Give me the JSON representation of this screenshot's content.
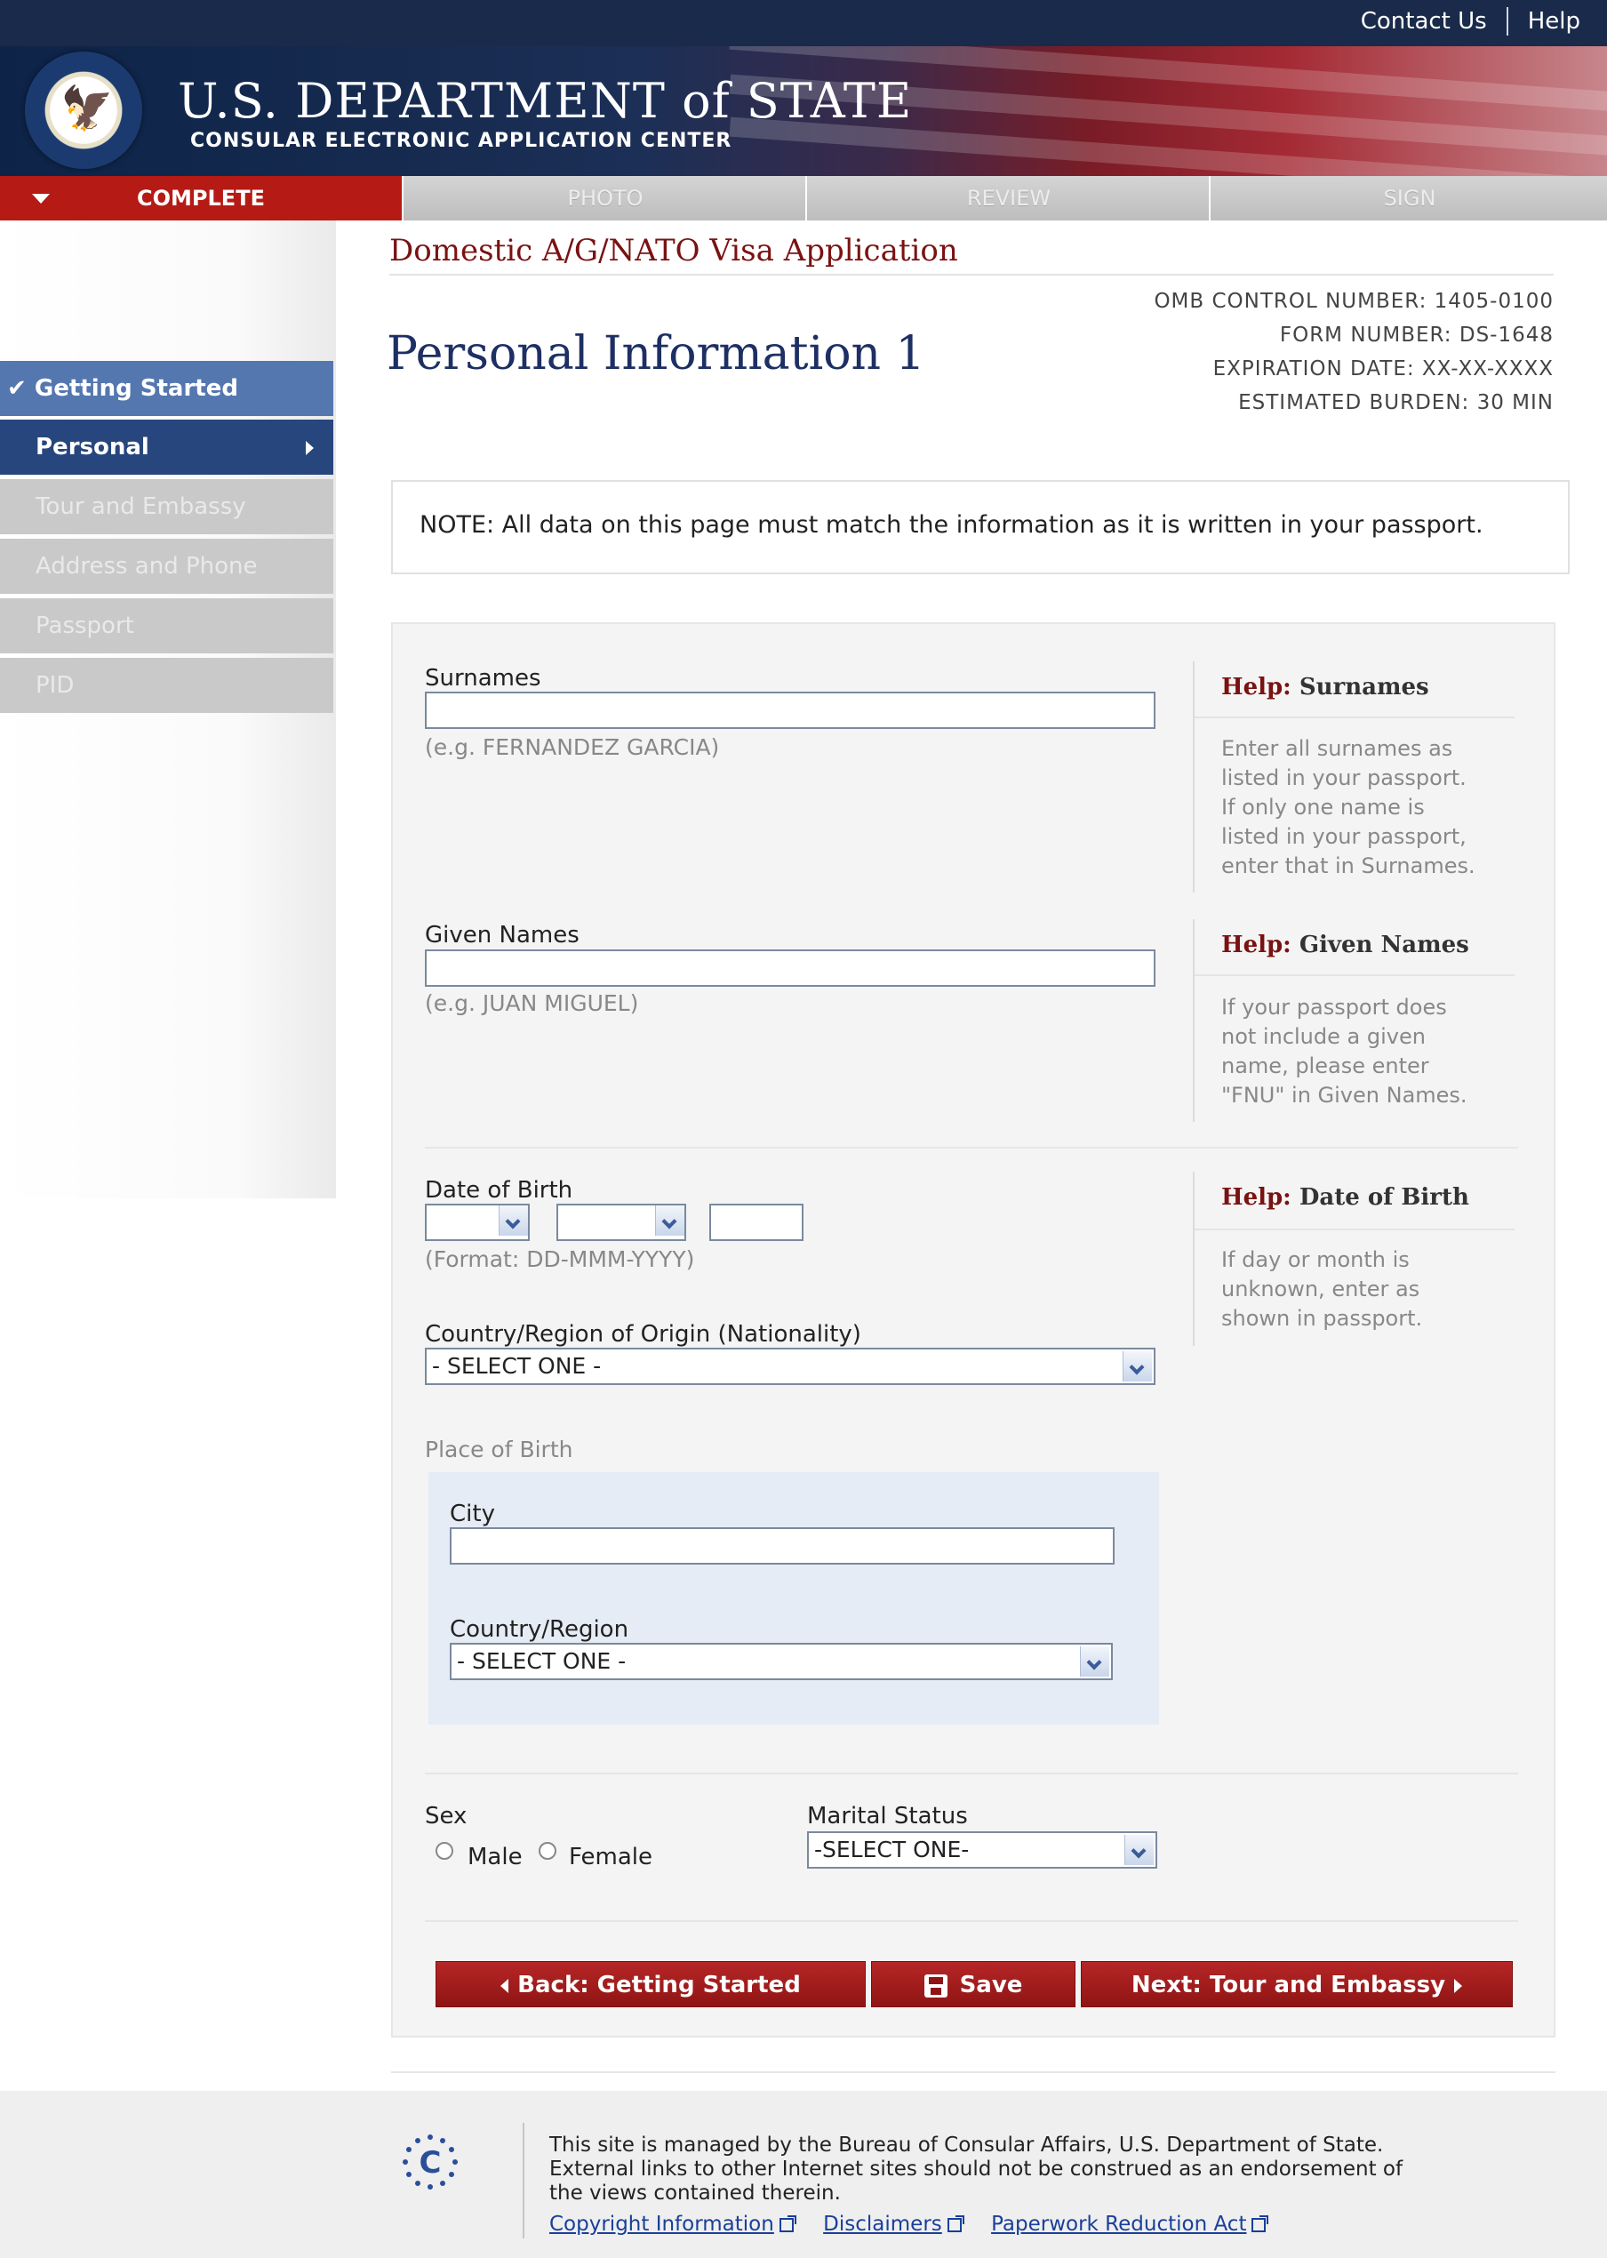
{
  "header": {
    "contact_us": "Contact Us",
    "help": "Help",
    "title_main": "U.S. DEPARTMENT of STATE",
    "subtitle": "CONSULAR ELECTRONIC APPLICATION CENTER"
  },
  "steps": [
    "COMPLETE",
    "PHOTO",
    "REVIEW",
    "SIGN"
  ],
  "sidebar": {
    "items": [
      {
        "label": "Getting Started",
        "state": "completed"
      },
      {
        "label": "Personal",
        "state": "current"
      },
      {
        "label": "Tour and Embassy",
        "state": "disabled"
      },
      {
        "label": "Address and Phone",
        "state": "disabled"
      },
      {
        "label": "Passport",
        "state": "disabled"
      },
      {
        "label": "PID",
        "state": "disabled"
      }
    ]
  },
  "page": {
    "app_title": "Domestic A/G/NATO Visa Application",
    "title": "Personal Information 1",
    "omb": {
      "control_number": "OMB CONTROL NUMBER:  1405-0100",
      "form_number": "FORM NUMBER:    DS-1648",
      "expiration": "EXPIRATION DATE: XX-XX-XXXX",
      "burden": "ESTIMATED BURDEN:     30 MIN"
    },
    "note": "NOTE: All data on this page must match the information as it is written in your passport."
  },
  "form": {
    "surnames": {
      "label": "Surnames",
      "value": "",
      "hint": "(e.g. FERNANDEZ GARCIA)"
    },
    "given_names": {
      "label": "Given Names",
      "value": "",
      "hint": "(e.g. JUAN MIGUEL)"
    },
    "dob": {
      "label": "Date of Birth",
      "day": "",
      "month": "",
      "year": "",
      "hint": "(Format: DD-MMM-YYYY)"
    },
    "nationality": {
      "label": "Country/Region of Origin (Nationality)",
      "selected": "- SELECT ONE -"
    },
    "place_of_birth": {
      "label": "Place of Birth",
      "city_label": "City",
      "city_value": "",
      "country_label": "Country/Region",
      "country_selected": "- SELECT ONE -"
    },
    "sex": {
      "label": "Sex",
      "options": [
        "Male",
        "Female"
      ]
    },
    "marital": {
      "label": "Marital Status",
      "selected": "-SELECT ONE-"
    }
  },
  "help": [
    {
      "prefix": "Help:",
      "topic": "Surnames",
      "lines": [
        "Enter all surnames as",
        "listed in your passport.",
        "If only one name is",
        "listed in your passport,",
        "enter that in Surnames."
      ]
    },
    {
      "prefix": "Help:",
      "topic": "Given Names",
      "lines": [
        "If your passport does",
        "not include a given",
        "name, please enter",
        "\"FNU\" in Given Names."
      ]
    },
    {
      "prefix": "Help:",
      "topic": "Date of Birth",
      "lines": [
        "If day or month is",
        "unknown, enter as",
        "shown in passport."
      ]
    }
  ],
  "buttons": {
    "back": "Back: Getting Started",
    "save": "Save",
    "next": "Next: Tour and Embassy"
  },
  "footer": {
    "text_line1": "This site is managed by the Bureau of Consular Affairs, U.S. Department of State.",
    "text_line2": "External links to other Internet sites should not be construed as an endorsement of",
    "text_line3": "the views contained therein.",
    "links": [
      "Copyright Information",
      "Disclaimers",
      "Paperwork Reduction Act"
    ]
  },
  "colors": {
    "header_navy": "#1a2a4a",
    "active_red": "#b51a14",
    "nav_blue": "#27467d",
    "accent_maroon": "#7a1212"
  }
}
